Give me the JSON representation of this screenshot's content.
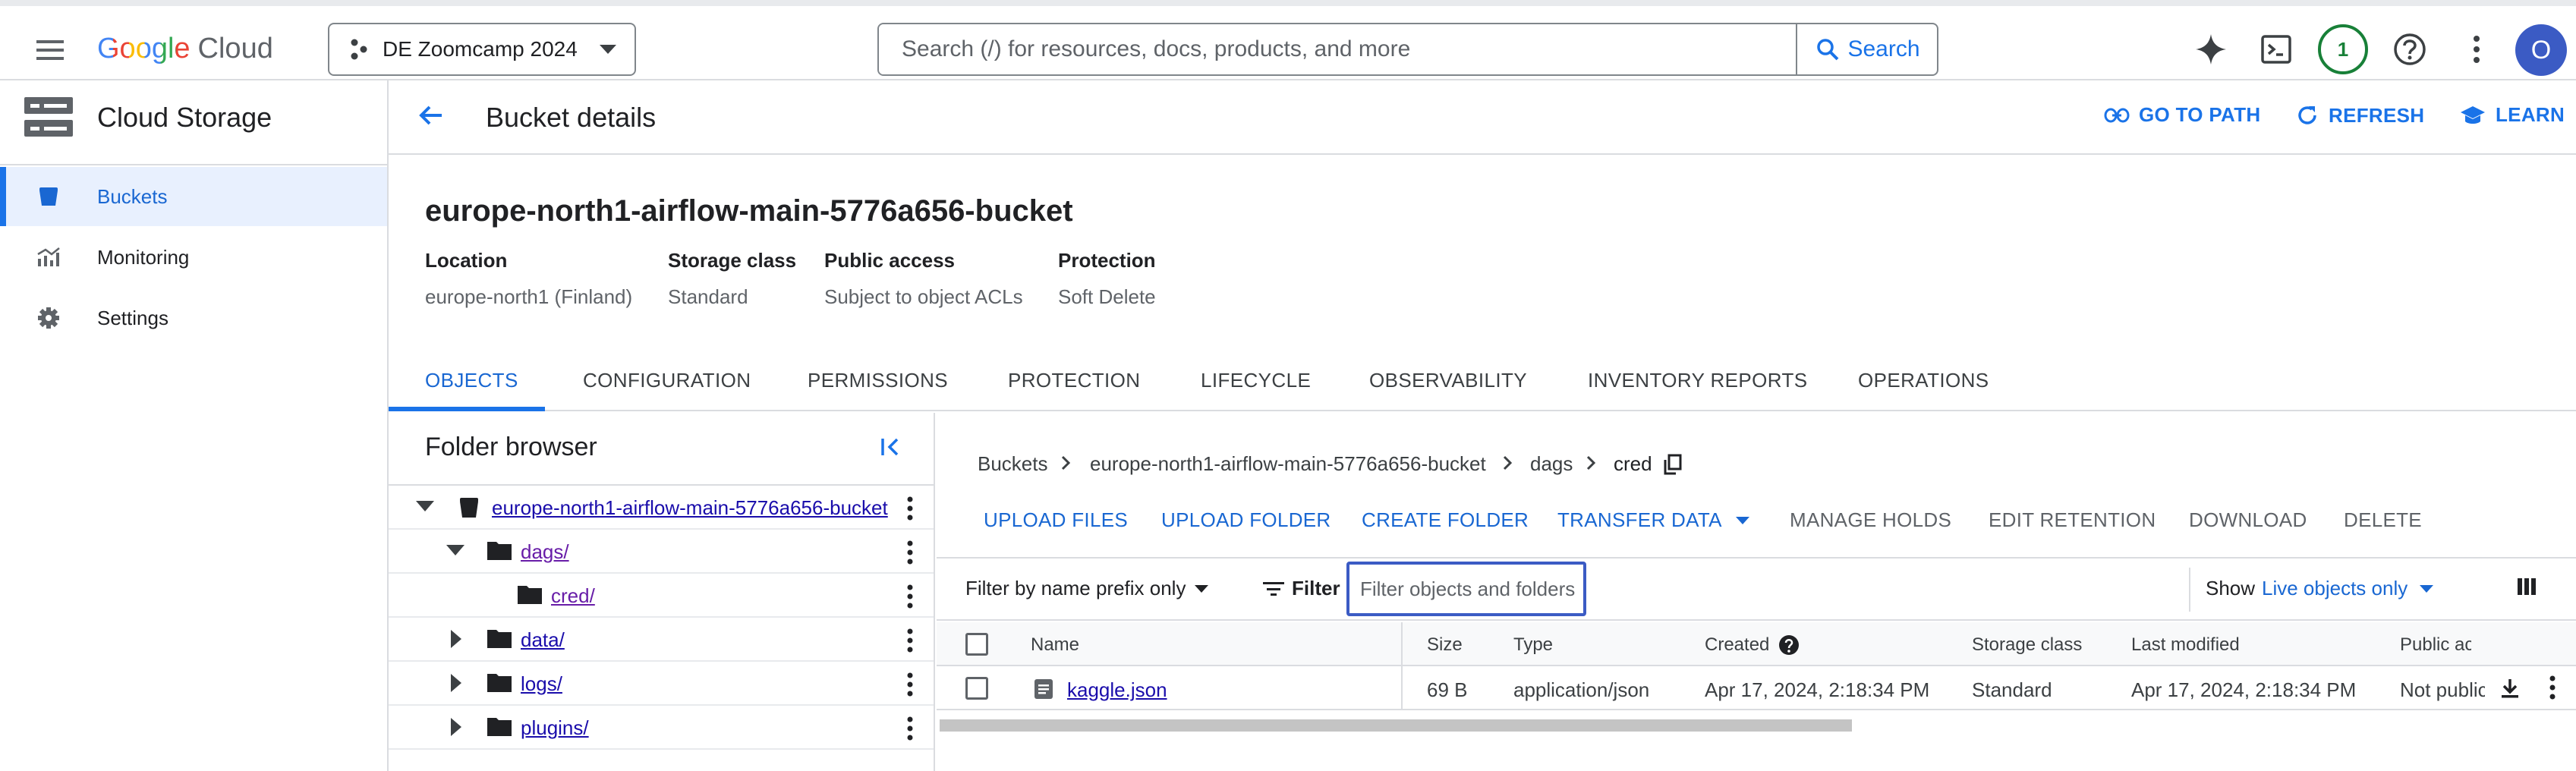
{
  "header": {
    "logo_google": "Google",
    "logo_cloud": "Cloud",
    "project": "DE Zoomcamp 2024",
    "search_placeholder": "Search (/) for resources, docs, products, and more",
    "search_button": "Search",
    "notification_count": "1",
    "avatar_initial": "O"
  },
  "sidebar": {
    "product": "Cloud Storage",
    "items": [
      {
        "label": "Buckets",
        "icon": "bucket-icon",
        "active": true
      },
      {
        "label": "Monitoring",
        "icon": "chart-icon",
        "active": false
      },
      {
        "label": "Settings",
        "icon": "gear-icon",
        "active": false
      }
    ]
  },
  "page": {
    "title": "Bucket details",
    "actions": {
      "go_to_path": "GO TO PATH",
      "refresh": "REFRESH",
      "learn": "LEARN"
    }
  },
  "bucket": {
    "name": "europe-north1-airflow-main-5776a656-bucket",
    "meta": [
      {
        "label": "Location",
        "value": "europe-north1 (Finland)"
      },
      {
        "label": "Storage class",
        "value": "Standard"
      },
      {
        "label": "Public access",
        "value": "Subject to object ACLs"
      },
      {
        "label": "Protection",
        "value": "Soft Delete"
      }
    ]
  },
  "tabs": [
    "OBJECTS",
    "CONFIGURATION",
    "PERMISSIONS",
    "PROTECTION",
    "LIFECYCLE",
    "OBSERVABILITY",
    "INVENTORY REPORTS",
    "OPERATIONS"
  ],
  "folder_browser": {
    "title": "Folder browser",
    "tree": [
      {
        "label": "europe-north1-airflow-main-5776a656-bucket",
        "kind": "bucket",
        "expanded": true
      },
      {
        "label": "dags/",
        "kind": "folder",
        "expanded": true
      },
      {
        "label": "cred/",
        "kind": "folder",
        "expanded": false
      },
      {
        "label": "data/",
        "kind": "folder",
        "expanded": false
      },
      {
        "label": "logs/",
        "kind": "folder",
        "expanded": false
      },
      {
        "label": "plugins/",
        "kind": "folder",
        "expanded": false
      }
    ]
  },
  "objects": {
    "breadcrumb": [
      "Buckets",
      "europe-north1-airflow-main-5776a656-bucket",
      "dags",
      "cred"
    ],
    "actions": [
      "UPLOAD FILES",
      "UPLOAD FOLDER",
      "CREATE FOLDER",
      "TRANSFER DATA",
      "MANAGE HOLDS",
      "EDIT RETENTION",
      "DOWNLOAD",
      "DELETE"
    ],
    "filter_mode": "Filter by name prefix only",
    "filter_label": "Filter",
    "filter_placeholder": "Filter objects and folders",
    "show_label": "Show",
    "show_value": "Live objects only",
    "columns": [
      "Name",
      "Size",
      "Type",
      "Created",
      "Storage class",
      "Last modified",
      "Public access"
    ],
    "rows": [
      {
        "name": "kaggle.json",
        "size": "69 B",
        "type": "application/json",
        "created": "Apr 17, 2024, 2:18:34 PM",
        "storage_class": "Standard",
        "last_modified": "Apr 17, 2024, 2:18:34 PM",
        "public_access": "Not public"
      }
    ]
  },
  "colors": {
    "accent": "#1a73e8",
    "active_nav_bg": "#e8f0fe",
    "border": "#dadce0",
    "notif_green": "#188038",
    "avatar": "#3b5bc4"
  }
}
